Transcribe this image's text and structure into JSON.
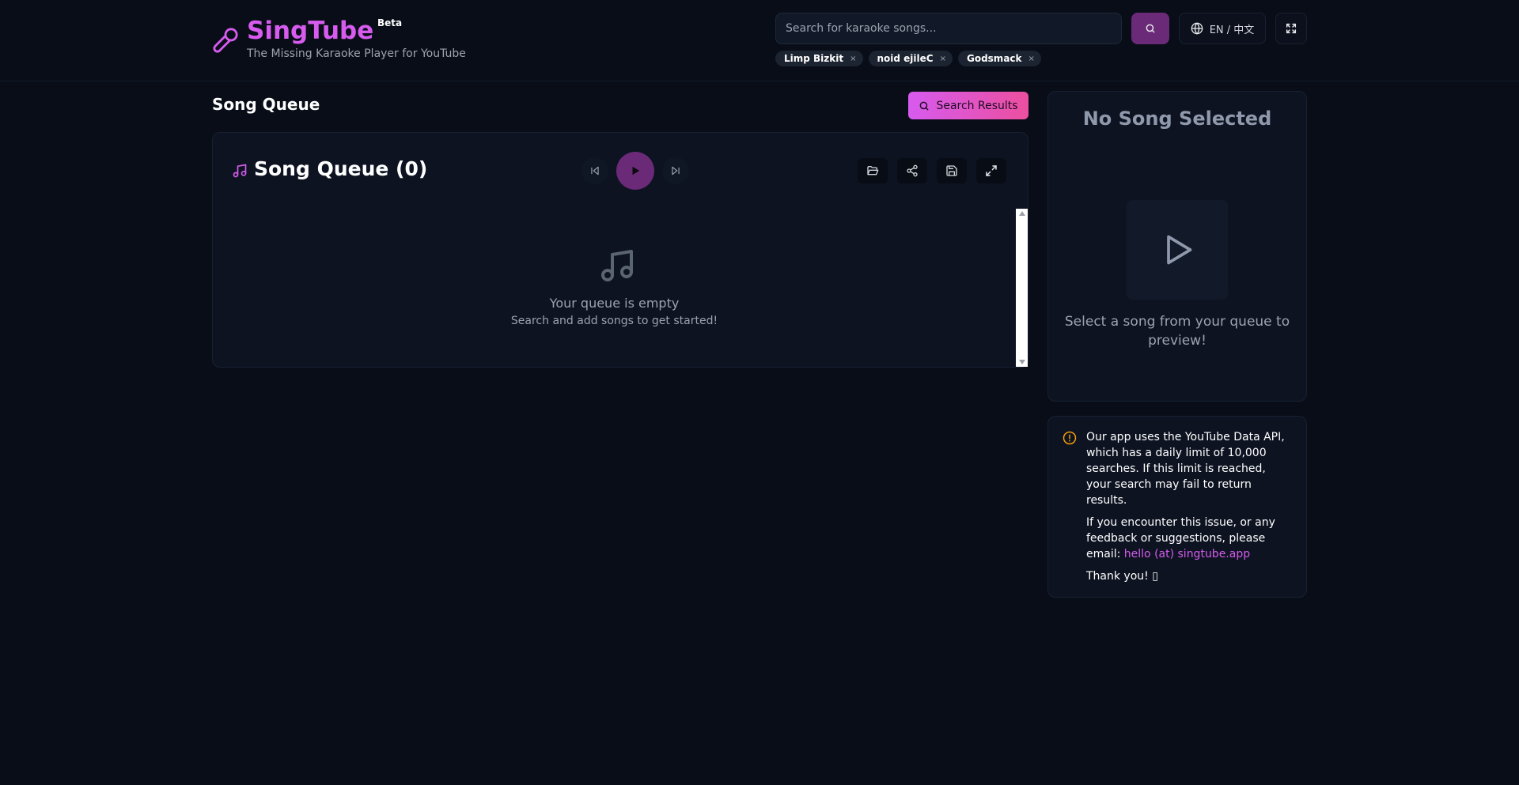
{
  "header": {
    "title": "SingTube",
    "badge": "Beta",
    "subtitle": "The Missing Karaoke Player for YouTube",
    "search_placeholder": "Search for karaoke songs...",
    "lang_label": "EN / 中文",
    "recent_searches": [
      "Limp Bizkit",
      "noid ejileC",
      "Godsmack"
    ],
    "tag_close": "×"
  },
  "main": {
    "section_title": "Song Queue",
    "search_results_label": "Search Results",
    "queue": {
      "title": "Song Queue (0)",
      "empty_title": "Your queue is empty",
      "empty_sub": "Search and add songs to get started!"
    }
  },
  "preview": {
    "title": "No Song Selected",
    "text": "Select a song from your queue to preview!"
  },
  "notice": {
    "para1": "Our app uses the YouTube Data API, which has a daily limit of 10,000 searches. If this limit is reached, your search may fail to return results.",
    "para2_prefix": "If you encounter this issue, or any feedback or suggestions, please email: ",
    "email": "hello (at) singtube.app",
    "thanks": "Thank you! ▯"
  },
  "colors": {
    "background": "#090d18",
    "accent": "#d65bee",
    "accent_dark": "#6b2a78",
    "panel": "#0d1321",
    "warning": "#f59e0b"
  },
  "icons": [
    "microphone-icon",
    "search-icon",
    "globe-icon",
    "fullscreen-icon",
    "music-note-icon",
    "skip-back-icon",
    "play-icon",
    "skip-forward-icon",
    "folder-open-icon",
    "share-icon",
    "save-icon",
    "expand-icon",
    "alert-circle-icon"
  ]
}
